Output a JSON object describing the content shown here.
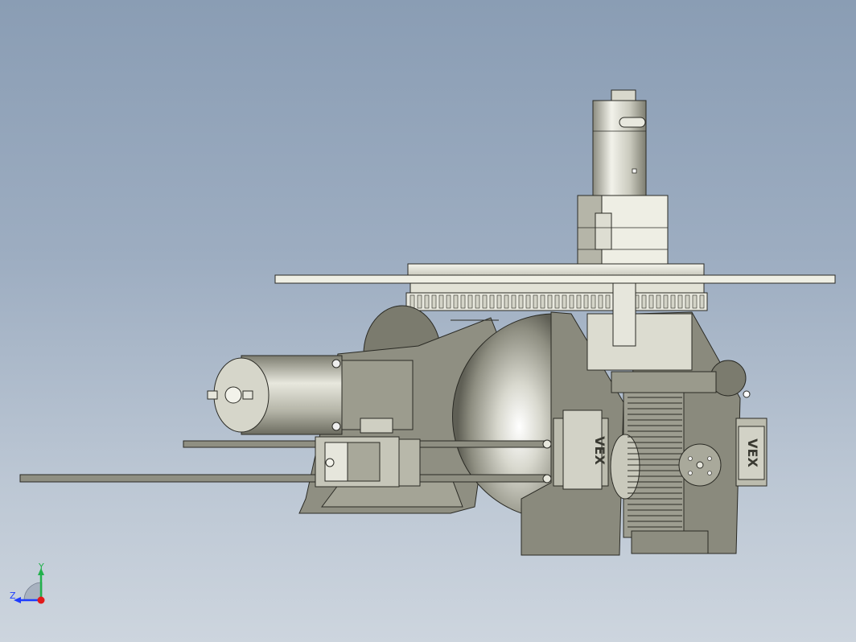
{
  "viewport": {
    "background_top": "#8a9db4",
    "background_bottom": "#cdd5de"
  },
  "model": {
    "shade_colors": {
      "frame": "#8c8c7e",
      "frame_dark": "#5e5e52",
      "metal_light": "#e6e6dc",
      "metal_mid": "#b9b9ab",
      "plate": "#efefe4",
      "edge": "#2a2a24"
    },
    "servo_logo_left": "VEX",
    "servo_logo_right": "VEX"
  },
  "triad": {
    "y_label": "Y",
    "z_label": "Z",
    "y_color": "#22b14c",
    "z_color": "#1e3cff",
    "origin_color": "#e21a1a"
  }
}
